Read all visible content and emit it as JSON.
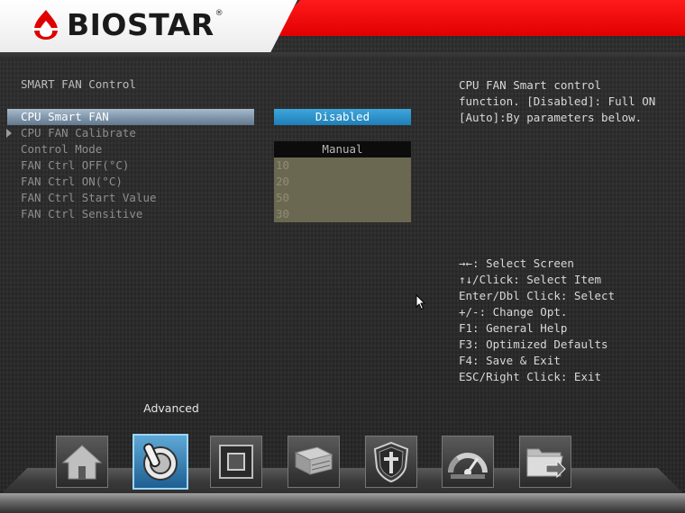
{
  "brand": {
    "name": "BIOSTAR",
    "reg": "®"
  },
  "section_title": "SMART FAN Control",
  "settings": [
    {
      "label": "CPU Smart FAN",
      "value": "Disabled"
    },
    {
      "label": "CPU FAN Calibrate"
    },
    {
      "label": "Control Mode",
      "value": "Manual"
    },
    {
      "label": "FAN Ctrl OFF(°C)",
      "value": "10"
    },
    {
      "label": "FAN Ctrl ON(°C)",
      "value": "20"
    },
    {
      "label": "FAN Ctrl Start Value",
      "value": "50"
    },
    {
      "label": "FAN Ctrl Sensitive",
      "value": "30"
    }
  ],
  "help": [
    "CPU FAN Smart control",
    "function. [Disabled]: Full ON",
    "[Auto]:By parameters below."
  ],
  "keys": [
    "→←: Select Screen",
    "↑↓/Click: Select Item",
    "Enter/Dbl Click: Select",
    "+/-: Change Opt.",
    "F1: General Help",
    "F3: Optimized Defaults",
    "F4: Save & Exit",
    "ESC/Right Click: Exit"
  ],
  "bottom_nav": {
    "active_label": "Advanced",
    "items": [
      {
        "icon": "home-icon"
      },
      {
        "icon": "advanced-icon",
        "active": true
      },
      {
        "icon": "chipset-icon"
      },
      {
        "icon": "boot-icon"
      },
      {
        "icon": "security-icon"
      },
      {
        "icon": "o-n-e-icon"
      },
      {
        "icon": "save-exit-icon"
      }
    ]
  },
  "colors": {
    "header_red": "#e10000",
    "highlight_row": "#7e95aa",
    "value_blue": "#1f7fb8",
    "value_olive": "#6a6850"
  }
}
